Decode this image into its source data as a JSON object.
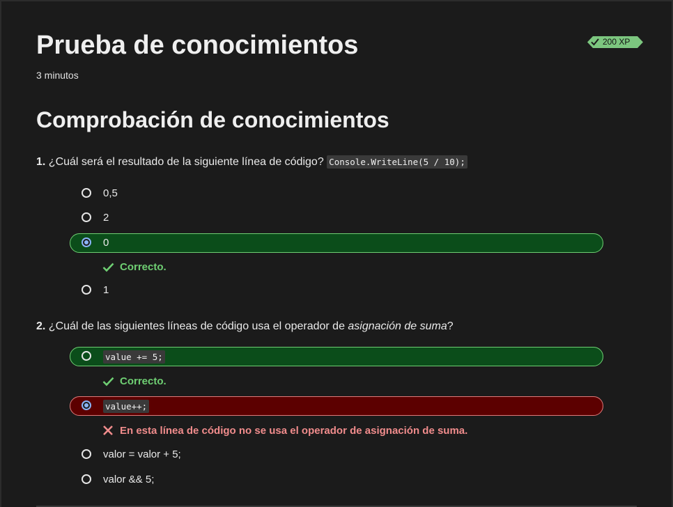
{
  "header": {
    "title": "Prueba de conocimientos",
    "duration": "3 minutos",
    "xp_badge": "200 XP"
  },
  "section": {
    "title": "Comprobación de conocimientos"
  },
  "questions": [
    {
      "number": "1.",
      "text_before": "¿Cuál será el resultado de la siguiente línea de código? ",
      "code": "Console.WriteLine(5 / 10);",
      "options": [
        {
          "label": "0,5",
          "selected": false
        },
        {
          "label": "2",
          "selected": false
        },
        {
          "label": "0",
          "selected": true,
          "state": "correct"
        },
        {
          "label": "1",
          "selected": false
        }
      ],
      "feedback": "Correcto."
    },
    {
      "number": "2.",
      "text_before": "¿Cuál de las siguientes líneas de código usa el operador de ",
      "text_em": "asignación de suma",
      "text_after": "?",
      "options": [
        {
          "label": "value += 5;",
          "selected": false,
          "state": "correct",
          "is_code": true
        },
        {
          "label": "value++;",
          "selected": true,
          "state": "wrong",
          "is_code": true
        },
        {
          "label": "valor = valor + 5;",
          "selected": false
        },
        {
          "label": "valor && 5;",
          "selected": false
        }
      ],
      "feedback_correct": "Correcto.",
      "feedback_wrong": "En esta línea de código no se usa el operador de asignación de suma."
    }
  ],
  "colors": {
    "background": "#1b1b1b",
    "correct_bg": "#0b4d1a",
    "correct_accent": "#6fcf73",
    "wrong_bg": "#5c0000",
    "wrong_accent": "#f08c8c",
    "badge": "#7cc67f"
  },
  "icons": {
    "badge": "checkmark-icon",
    "correct": "checkmark-icon",
    "wrong": "x-mark-icon",
    "radio": "radio-button-icon"
  }
}
